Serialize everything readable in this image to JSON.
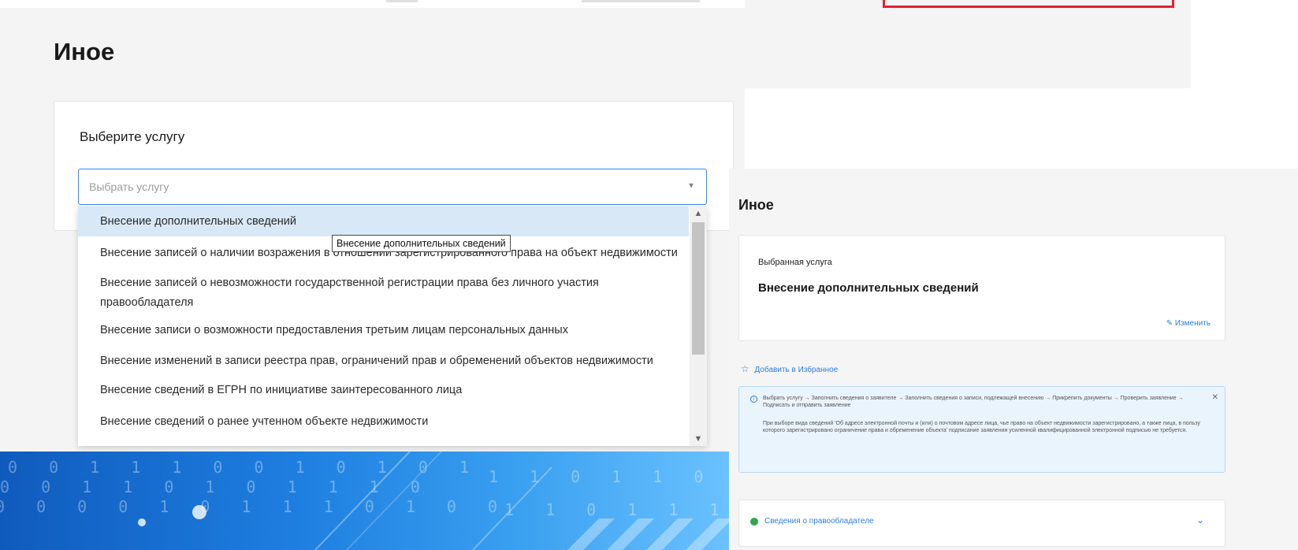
{
  "left": {
    "page_title": "Иное",
    "card_label": "Выберите услугу",
    "select_placeholder": "Выбрать услугу",
    "dropdown_items": [
      "Внесение дополнительных сведений",
      "Внесение записей о наличии возражения в отношении зарегистрированного права на объект недвижимости",
      "Внесение записей о невозможности государственной регистрации права без личного участия правообладателя",
      "Внесение записи о возможности предоставления третьим лицам персональных данных",
      "Внесение изменений в записи реестра прав, ограничений прав и обременений объектов недвижимости",
      "Внесение сведений в ЕГРН по инициативе заинтересованного лица",
      "Внесение сведений о ранее учтенном объекте недвижимости"
    ],
    "tooltip": "Внесение дополнительных сведений"
  },
  "right": {
    "page_title": "Иное",
    "selected_label": "Выбранная услуга",
    "selected_value": "Внесение дополнительных сведений",
    "change_label": "Изменить",
    "favorite_label": "Добавить в Избранное",
    "info_steps": "Выбрать услугу → Заполнить сведения о заявителе → Заполнить сведения о записи, подлежащей внесению → Прикрепить документы → Проверить заявление → Подписать и отправить заявление",
    "info_note": "При выборе вида сведений 'Об адресе электронной почты и (или) о почтовом адресе лица, чье право на объект недвижимости зарегистрировано, а также лица, в пользу которого зарегистрировано ограничение права и обременение объекта' подписание заявления усиленной квалифицированной электронной подписью не требуется.",
    "accordion_label": "Сведения о правообладателе"
  },
  "banner": {
    "digits_row1": "0 0 1 1 1 0 0 1 0 1 0 1",
    "digits_row2": "0 0 1 1 0 1 0 1 1 1 0",
    "digits_row3": "0 0 0 0 1 0 1 1 1 0 1 0 0",
    "digits_row4": "1 1 0 1 1 0 0 0",
    "digits_row5": "1 1 0 1 1 1 0"
  },
  "icons": {
    "caret": "▾",
    "scroll_up": "▲",
    "scroll_down": "▼",
    "pencil": "✎",
    "star": "☆",
    "info": "i",
    "close": "✕",
    "chevron": "⌄"
  },
  "colors": {
    "accent": "#3f83f8",
    "link": "#2f7de1",
    "success": "#2ea84a",
    "highlight": "#d8e8f7",
    "frame_red": "#e3212f"
  }
}
